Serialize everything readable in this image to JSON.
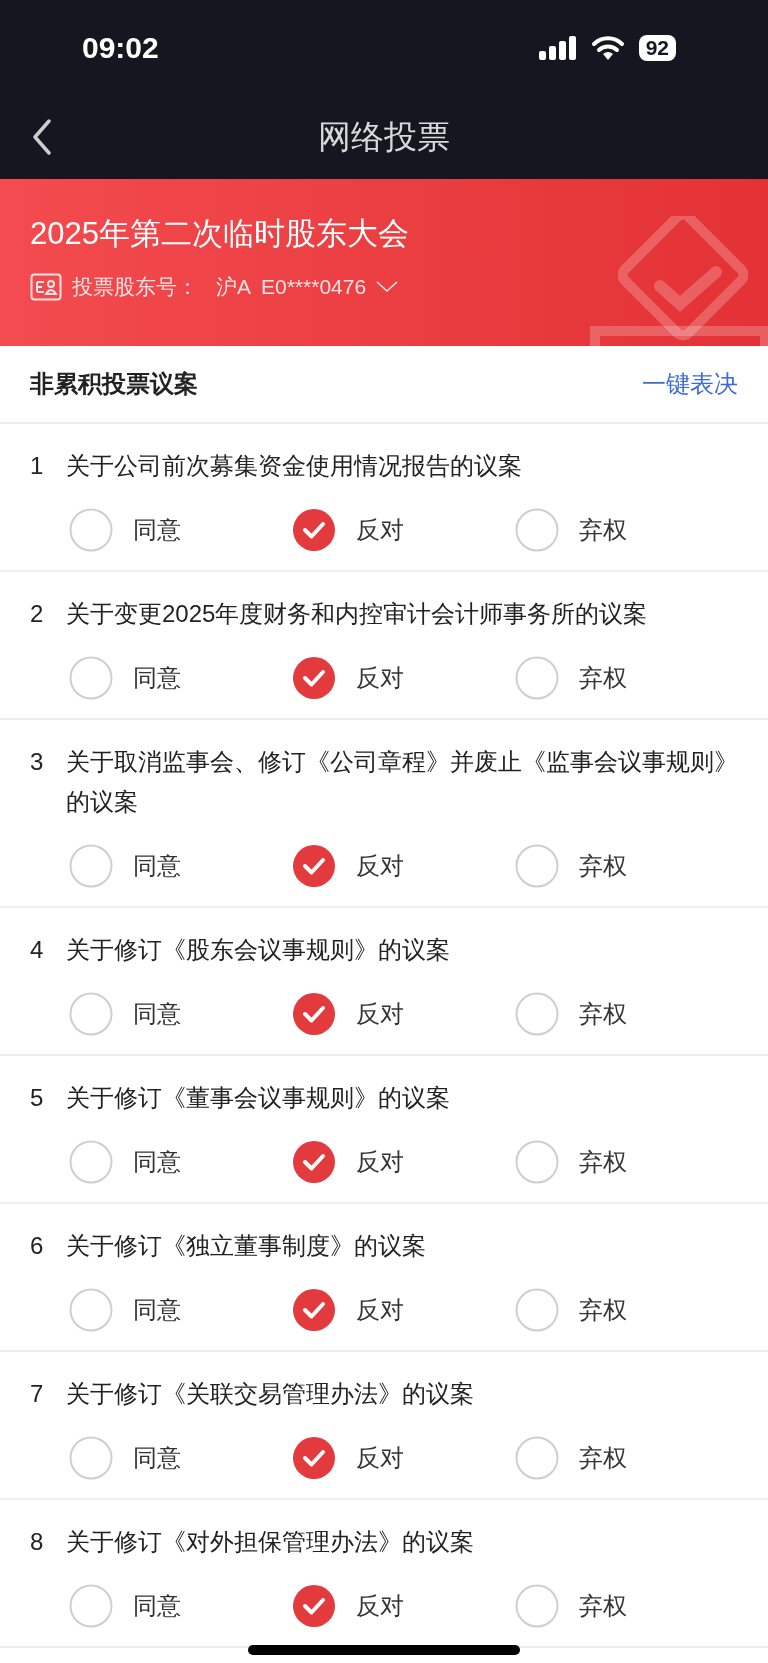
{
  "status_bar": {
    "time": "09:02",
    "battery": "92"
  },
  "nav": {
    "title": "网络投票"
  },
  "meeting": {
    "title": "2025年第二次临时股东大会",
    "account_label": "投票股东号：",
    "account_market": "沪A",
    "account_number": "E0****0476"
  },
  "section": {
    "title": "非累积投票议案",
    "action": "一键表决"
  },
  "items": [
    {
      "number": "1",
      "text": "关于公司前次募集资金使用情况报告的议案",
      "options": [
        {
          "label": "同意",
          "selected": false
        },
        {
          "label": "反对",
          "selected": true
        },
        {
          "label": "弃权",
          "selected": false
        }
      ]
    },
    {
      "number": "2",
      "text": "关于变更2025年度财务和内控审计会计师事务所的议案",
      "options": [
        {
          "label": "同意",
          "selected": false
        },
        {
          "label": "反对",
          "selected": true
        },
        {
          "label": "弃权",
          "selected": false
        }
      ]
    },
    {
      "number": "3",
      "text": "关于取消监事会、修订《公司章程》并废止《监事会议事规则》的议案",
      "options": [
        {
          "label": "同意",
          "selected": false
        },
        {
          "label": "反对",
          "selected": true
        },
        {
          "label": "弃权",
          "selected": false
        }
      ]
    },
    {
      "number": "4",
      "text": "关于修订《股东会议事规则》的议案",
      "options": [
        {
          "label": "同意",
          "selected": false
        },
        {
          "label": "反对",
          "selected": true
        },
        {
          "label": "弃权",
          "selected": false
        }
      ]
    },
    {
      "number": "5",
      "text": "关于修订《董事会议事规则》的议案",
      "options": [
        {
          "label": "同意",
          "selected": false
        },
        {
          "label": "反对",
          "selected": true
        },
        {
          "label": "弃权",
          "selected": false
        }
      ]
    },
    {
      "number": "6",
      "text": "关于修订《独立董事制度》的议案",
      "options": [
        {
          "label": "同意",
          "selected": false
        },
        {
          "label": "反对",
          "selected": true
        },
        {
          "label": "弃权",
          "selected": false
        }
      ]
    },
    {
      "number": "7",
      "text": "关于修订《关联交易管理办法》的议案",
      "options": [
        {
          "label": "同意",
          "selected": false
        },
        {
          "label": "反对",
          "selected": true
        },
        {
          "label": "弃权",
          "selected": false
        }
      ]
    },
    {
      "number": "8",
      "text": "关于修订《对外担保管理办法》的议案",
      "options": [
        {
          "label": "同意",
          "selected": false
        },
        {
          "label": "反对",
          "selected": true
        },
        {
          "label": "弃权",
          "selected": false
        }
      ]
    }
  ]
}
